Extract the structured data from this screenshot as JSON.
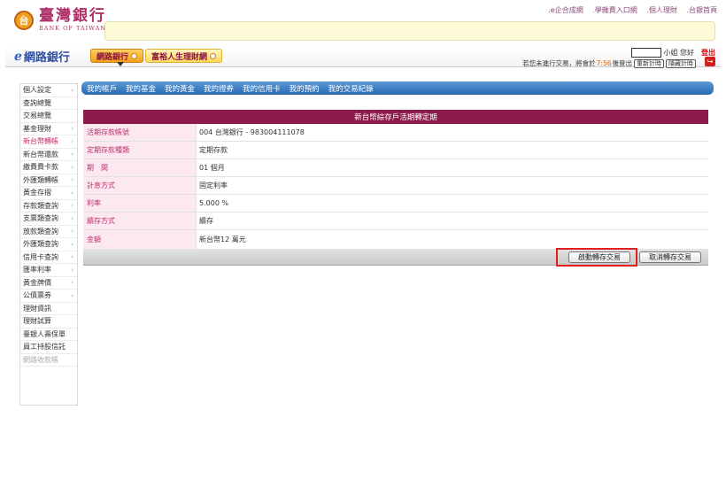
{
  "top_links": [
    ".e企合成網",
    ".學雜費入口網",
    ".個人理財",
    ".台銀首頁"
  ],
  "logo": {
    "badge": "台",
    "name_cn": "臺灣銀行",
    "name_en": "BANK OF TAIWAN"
  },
  "brand": {
    "icon": "e-link-icon",
    "label": "網路銀行"
  },
  "nav_tabs": [
    {
      "label": "網路銀行",
      "active": true
    },
    {
      "label": "富裕人生理財網",
      "active": false
    }
  ],
  "user": {
    "greeting": "小姐 您好",
    "logout_label": "登出"
  },
  "session": {
    "prefix": "若您未進行交易，將會於",
    "timer": "7:56",
    "suffix": "後登出",
    "reset_label": "重新計時",
    "hide_label": "隱藏計時"
  },
  "sidebar": [
    {
      "label": "個人設定",
      "arrow": true
    },
    {
      "label": "查詢總覽",
      "arrow": false
    },
    {
      "label": "交易總覽",
      "arrow": false
    },
    {
      "label": "基金理財",
      "arrow": true
    },
    {
      "label": "新台幣轉帳",
      "arrow": true,
      "active": true
    },
    {
      "label": "新台幣還款",
      "arrow": true
    },
    {
      "label": "繳費費卡款",
      "arrow": true
    },
    {
      "label": "外匯類轉帳",
      "arrow": true
    },
    {
      "label": "黃金存摺",
      "arrow": true
    },
    {
      "label": "存款類查詢",
      "arrow": true
    },
    {
      "label": "支票類查詢",
      "arrow": true
    },
    {
      "label": "放款類查詢",
      "arrow": true
    },
    {
      "label": "外匯類查詢",
      "arrow": true
    },
    {
      "label": "信用卡查詢",
      "arrow": true
    },
    {
      "label": "匯率利率",
      "arrow": true
    },
    {
      "label": "黃金牌價",
      "arrow": true
    },
    {
      "label": "公債票券",
      "arrow": true
    },
    {
      "label": "理財資訊",
      "arrow": false
    },
    {
      "label": "理財試算",
      "arrow": false
    },
    {
      "label": "臺銀人壽保單",
      "arrow": false
    },
    {
      "label": "員工持股信託",
      "arrow": false
    },
    {
      "label": "網路收款帳",
      "arrow": false,
      "disabled": true
    }
  ],
  "sub_nav": [
    "我的帳戶",
    "我的基金",
    "我的黃金",
    "我的證券",
    "我的信用卡",
    "我的預約",
    "我的交易紀錄"
  ],
  "panel": {
    "title": "新台幣綜存戶活期轉定期",
    "rows": [
      {
        "label": "活期存款帳號",
        "value": "004 台灣銀行 - 983004111078"
      },
      {
        "label": "定期存款種類",
        "value": "定期存款"
      },
      {
        "label": "期　間",
        "value": "01 個月"
      },
      {
        "label": "計息方式",
        "value": "固定利率"
      },
      {
        "label": "利率",
        "value": "5.000 %"
      },
      {
        "label": "續存方式",
        "value": "續存"
      },
      {
        "label": "金額",
        "value": "新台幣12 萬元"
      }
    ],
    "confirm_label": "啟動轉存交易",
    "cancel_label": "取消轉存交易"
  }
}
